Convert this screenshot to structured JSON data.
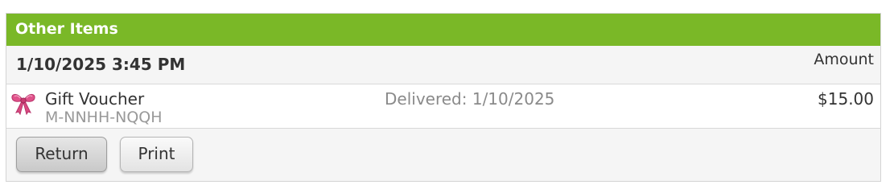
{
  "panel": {
    "title": "Other Items"
  },
  "order": {
    "datetime": "1/10/2025 3:45 PM",
    "amount_header": "Amount"
  },
  "items": [
    {
      "icon": "gift-bow-icon",
      "name": "Gift Voucher",
      "code": "M-NNHH-NQQH",
      "status": "Delivered: 1/10/2025",
      "amount": "$15.00"
    }
  ],
  "actions": {
    "return_label": "Return",
    "print_label": "Print"
  },
  "colors": {
    "header_bg": "#7ab827",
    "header_text": "#ffffff",
    "bow": "#e0528a"
  }
}
